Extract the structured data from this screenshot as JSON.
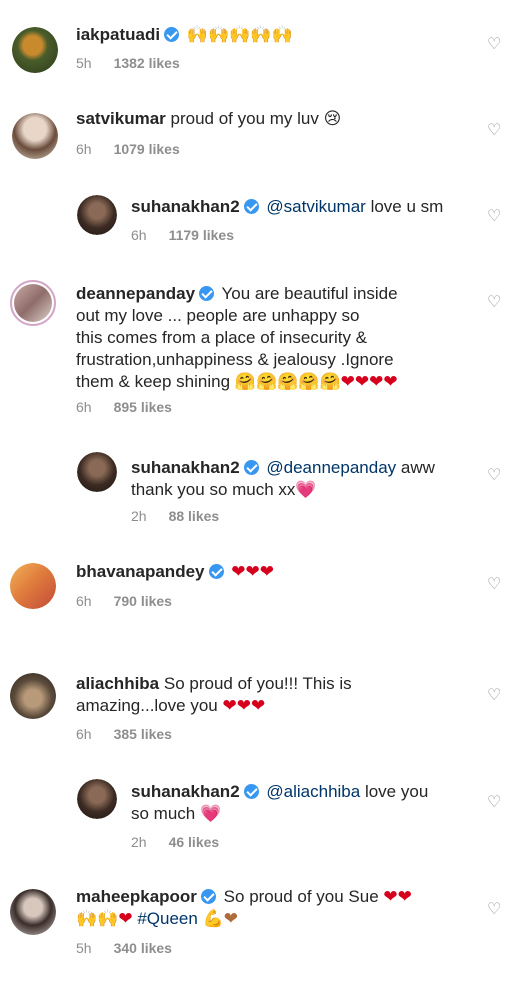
{
  "comments": [
    {
      "user": "iakpatuadi",
      "verified": true,
      "text": "",
      "emoji": "🙌🙌🙌🙌🙌",
      "time": "5h",
      "likes": "1382 likes"
    },
    {
      "user": "satvikumar",
      "verified": false,
      "text": "proud of you my luv",
      "emoji": "😢",
      "time": "6h",
      "likes": "1079 likes"
    },
    {
      "user": "suhanakhan2",
      "verified": true,
      "mention": "@satvikumar",
      "text": "love u sm",
      "time": "6h",
      "likes": "1179 likes"
    },
    {
      "user": "deannepanday",
      "verified": true,
      "text_lines": [
        "You are beautiful inside",
        "out my love ... people are unhappy so",
        "this  comes from a place of insecurity &",
        "frustration,unhappiness & jealousy .Ignore",
        "them & keep shining"
      ],
      "emoji": "🤗🤗🤗🤗🤗❤❤❤❤",
      "time": "6h",
      "likes": "895 likes"
    },
    {
      "user": "suhanakhan2",
      "verified": true,
      "mention": "@deannepanday",
      "text_lines": [
        "aww",
        "thank you so much xx"
      ],
      "emoji": "💗",
      "time": "2h",
      "likes": "88 likes"
    },
    {
      "user": "bhavanapandey",
      "verified": true,
      "text": "",
      "emoji": "❤❤❤",
      "time": "6h",
      "likes": "790 likes"
    },
    {
      "user": "aliachhiba",
      "verified": false,
      "text_lines": [
        "So proud of you!!! This is",
        "amazing...love you"
      ],
      "emoji": "❤❤❤",
      "time": "6h",
      "likes": "385 likes"
    },
    {
      "user": "suhanakhan2",
      "verified": true,
      "mention": "@aliachhiba",
      "text_lines": [
        "love you",
        "so much"
      ],
      "emoji": "💗",
      "time": "2h",
      "likes": "46 likes"
    },
    {
      "user": "maheepkapoor",
      "verified": true,
      "text_lines": [
        "So proud of you Sue",
        "#Queen"
      ],
      "emoji_a": "❤❤",
      "emoji_b": "🙌🙌❤",
      "emoji_c": "💪❤",
      "time": "5h",
      "likes": "340 likes"
    }
  ],
  "icons": {
    "heart": "heart-outline-icon",
    "verified": "verified-badge-icon"
  },
  "colors": {
    "mention": "#003569",
    "meta": "#8e8e8e",
    "verified": "#3897f0"
  }
}
